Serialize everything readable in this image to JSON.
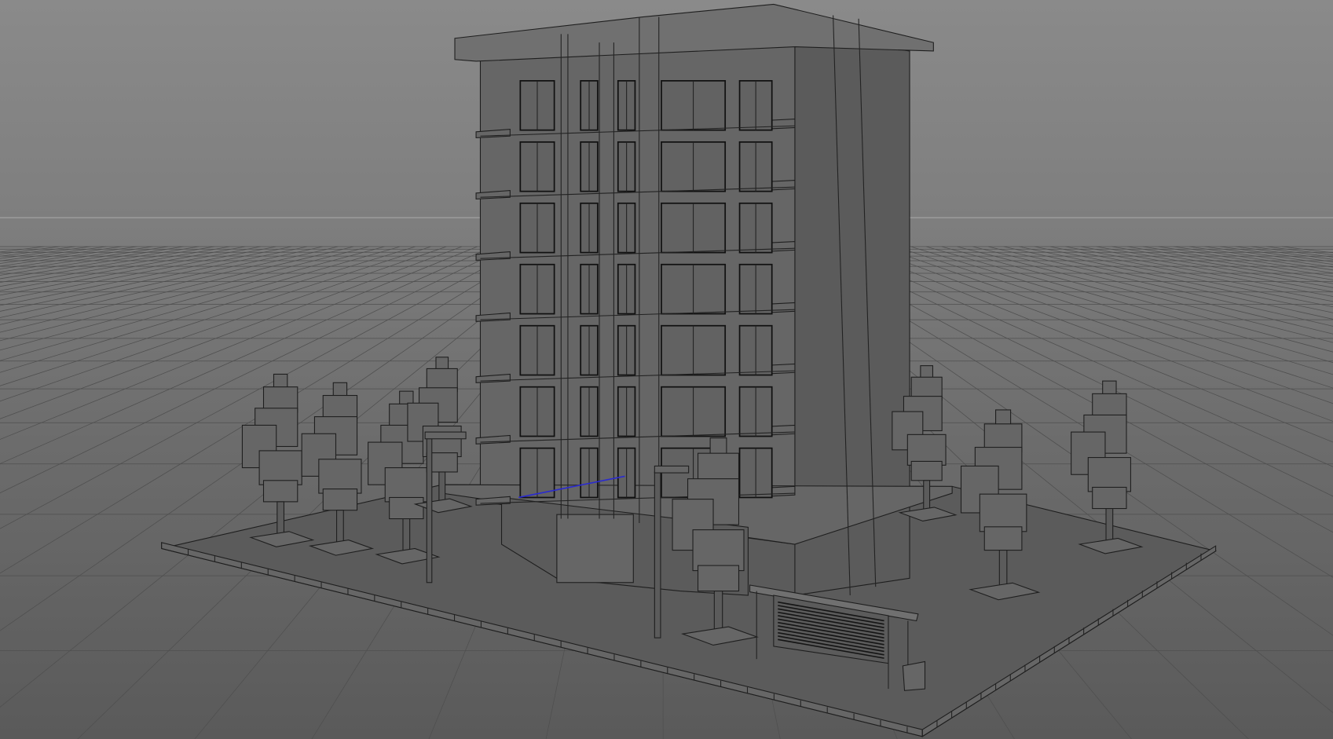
{
  "viewport": {
    "mode": "perspective-wireframe-on-shaded",
    "colors": {
      "background_top": "#8a8a8a",
      "background_bottom": "#5a5a5a",
      "grid_line": "#4f4f4f",
      "horizon_line": "#a6a6a6",
      "wireframe": "#1e1e1e",
      "surface": "#666666",
      "selected_edge": "#2a2ad0"
    }
  },
  "scene": {
    "objects": [
      "apartment-building",
      "ground-platform",
      "trees",
      "street-lamps",
      "bus-shelter",
      "trash-bin"
    ]
  }
}
